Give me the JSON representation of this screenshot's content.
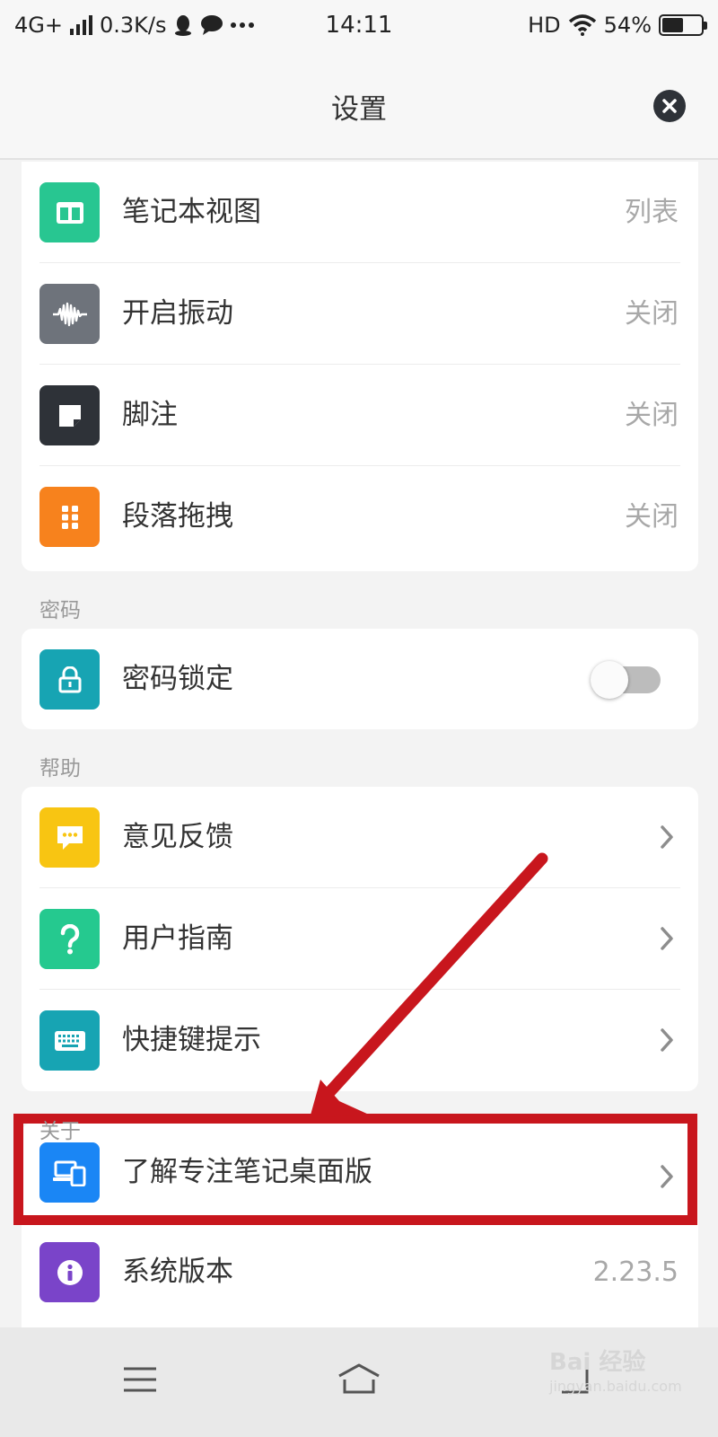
{
  "status_bar": {
    "network": "4G+",
    "speed": "0.3K/s",
    "time": "14:11",
    "hd": "HD",
    "battery_text": "54%",
    "battery_level": 0.54,
    "icons": [
      "qq-icon",
      "chat-bubble-icon",
      "more-dots-icon",
      "wifi-icon",
      "battery-icon"
    ]
  },
  "header": {
    "title": "设置"
  },
  "display_section": {
    "items": [
      {
        "label": "笔记本视图",
        "value": "列表",
        "icon": "notebook-view-icon",
        "color": "#28c691"
      },
      {
        "label": "开启振动",
        "value": "关闭",
        "icon": "vibration-wave-icon",
        "color": "#6e737b"
      },
      {
        "label": "脚注",
        "value": "关闭",
        "icon": "footnote-icon",
        "color": "#2e3238"
      },
      {
        "label": "段落拖拽",
        "value": "关闭",
        "icon": "drag-handle-icon",
        "color": "#f7821d"
      }
    ]
  },
  "password_section": {
    "header": "密码",
    "item": {
      "label": "密码锁定",
      "icon": "lock-icon",
      "color": "#17a4b3",
      "toggle_on": false
    }
  },
  "help_section": {
    "header": "帮助",
    "items": [
      {
        "label": "意见反馈",
        "icon": "feedback-icon",
        "color": "#f8c512"
      },
      {
        "label": "用户指南",
        "icon": "question-icon",
        "color": "#25c98f"
      },
      {
        "label": "快捷键提示",
        "icon": "keyboard-icon",
        "color": "#17a4b3"
      }
    ]
  },
  "about_section": {
    "header": "关于",
    "items": [
      {
        "label": "了解专注笔记桌面版",
        "icon": "desktop-devices-icon",
        "color": "#1a86f5"
      },
      {
        "label": "系统版本",
        "value": "2.23.5",
        "icon": "info-icon",
        "color": "#7a44c9"
      }
    ]
  },
  "bottom_nav": {
    "icons": [
      "menu-icon",
      "home-icon",
      "back-icon"
    ]
  },
  "watermark": {
    "text": "Bai 经验",
    "sub": "jingyan.baidu.com"
  },
  "colors": {
    "highlight": "#c8161d",
    "background": "#f3f3f3"
  }
}
